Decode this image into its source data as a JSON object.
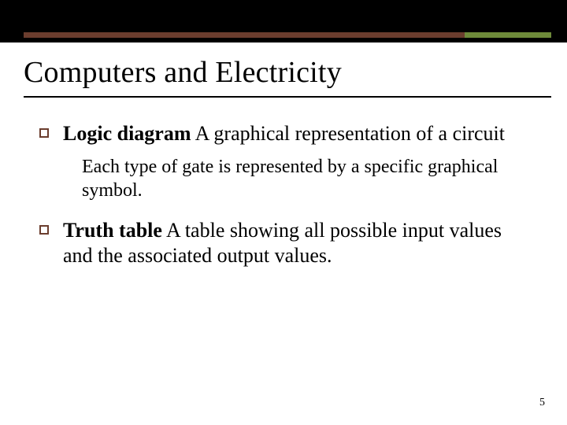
{
  "title": "Computers and Electricity",
  "bullets": [
    {
      "term": "Logic diagram",
      "definition": "  A graphical representation of a circuit",
      "sub": "Each type of gate is represented by a specific graphical symbol."
    },
    {
      "term": "Truth table",
      "definition": "  A table showing all possible input values and the associated output values.",
      "sub": ""
    }
  ],
  "page_number": "5"
}
